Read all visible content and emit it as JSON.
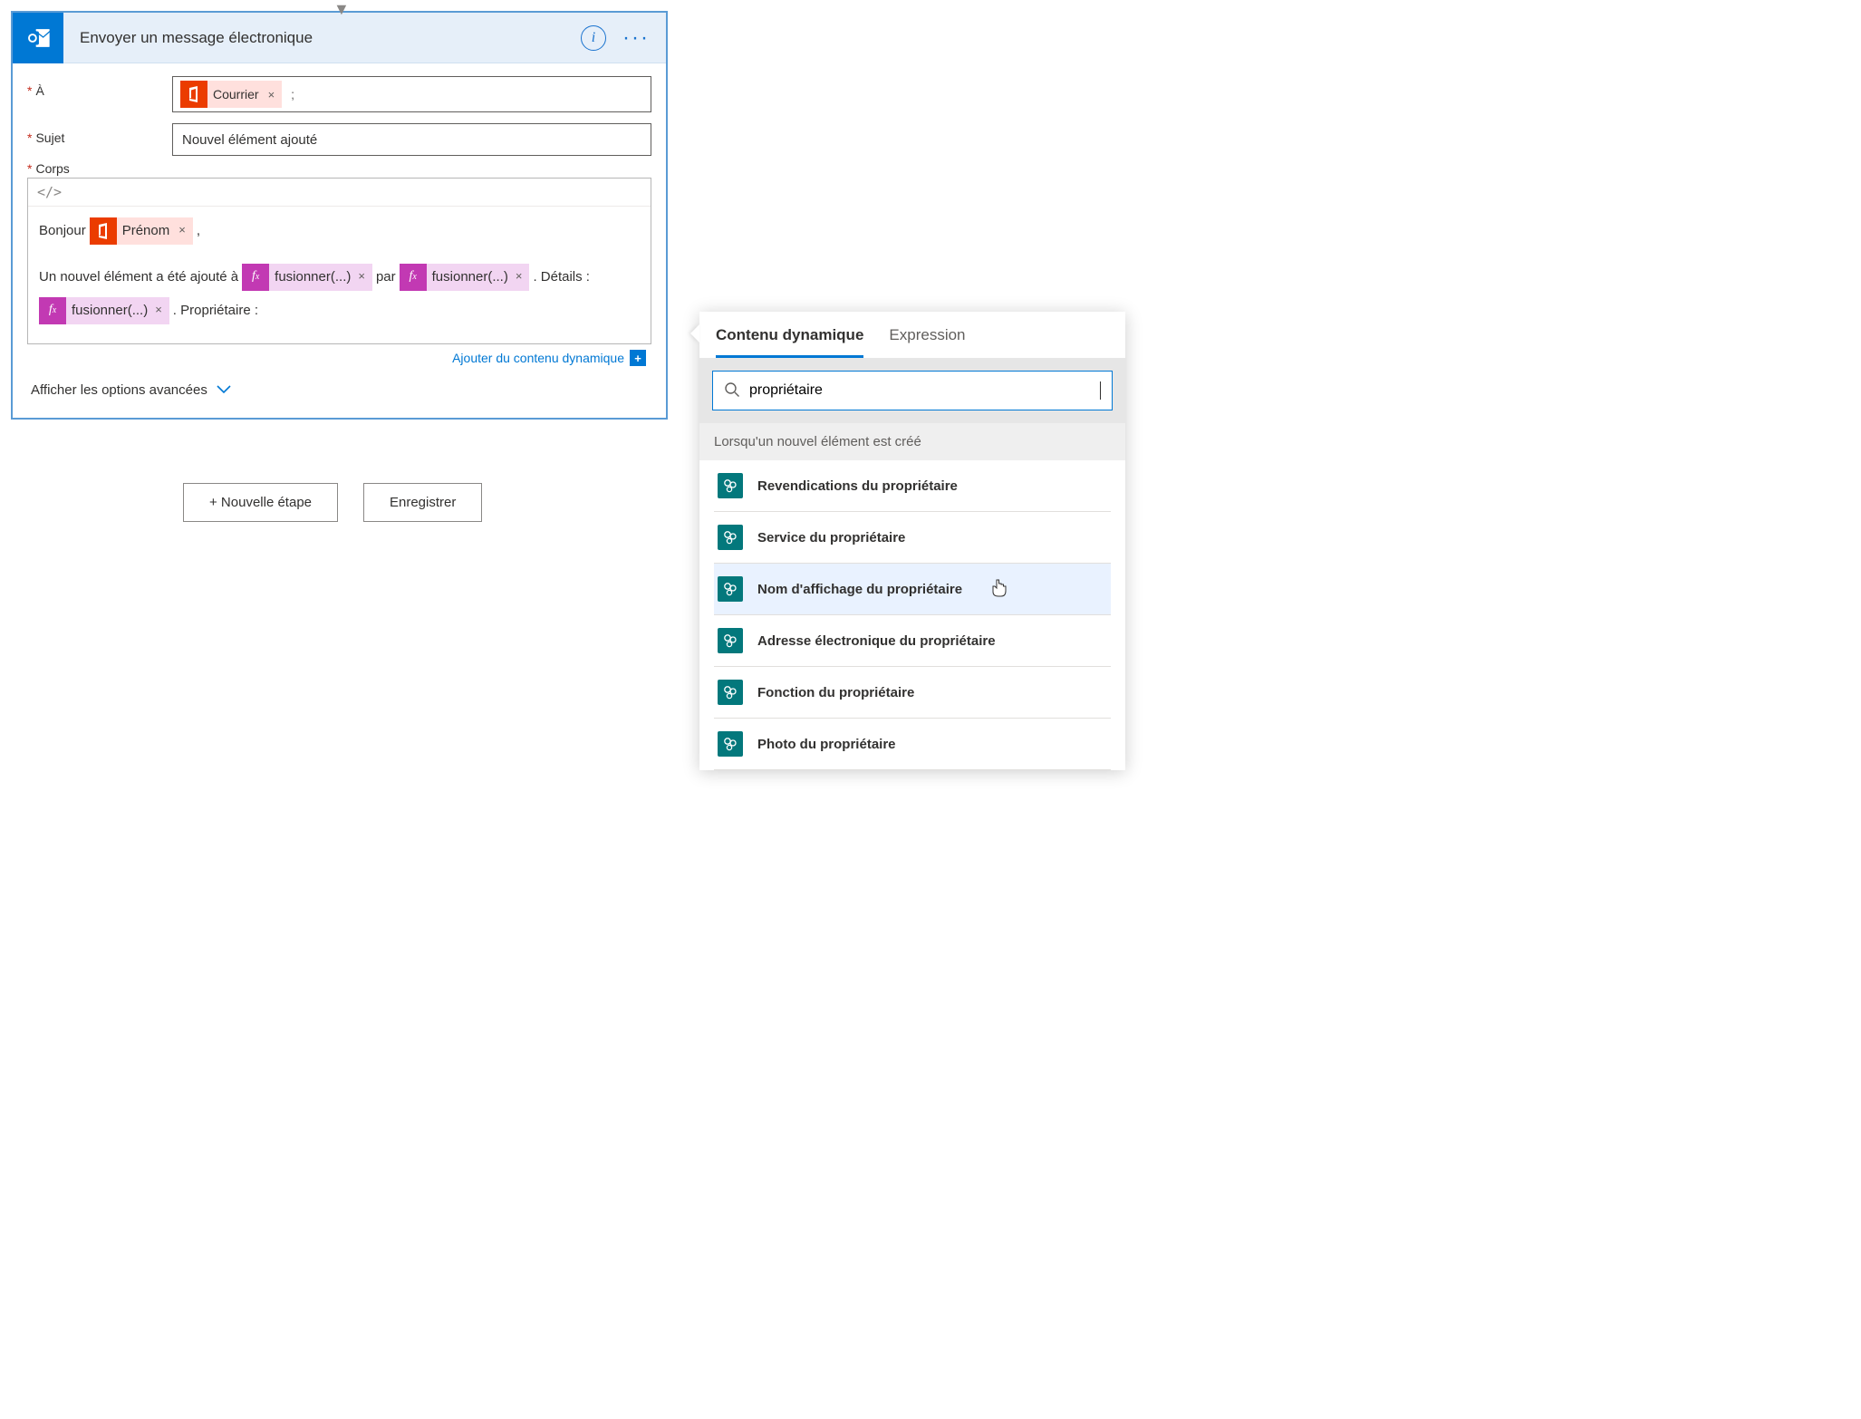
{
  "card": {
    "title": "Envoyer un message électronique"
  },
  "form": {
    "to_label": "À",
    "to_token": "Courrier",
    "to_sep": ";",
    "subject_label": "Sujet",
    "subject_value": "Nouvel élément ajouté",
    "body_label": "Corps",
    "body_toolbar": "</>",
    "line1_prefix": "Bonjour",
    "line1_token": "Prénom",
    "line1_suffix": ",",
    "line2_t1": "Un nouvel élément a été ajouté à",
    "fx_label": "fusionner(...)",
    "line2_t2": "par",
    "line2_t3": ". Détails :",
    "line3_t1": ". Propriétaire :",
    "dynamic_link": "Ajouter du contenu dynamique",
    "advanced": "Afficher les options avancées"
  },
  "footer": {
    "new_step": "+ Nouvelle étape",
    "save": "Enregistrer"
  },
  "panel": {
    "tab_dc": "Contenu dynamique",
    "tab_expr": "Expression",
    "search_value": "propriétaire",
    "section": "Lorsqu'un nouvel élément est créé",
    "items": [
      "Revendications du propriétaire",
      "Service du propriétaire",
      "Nom d'affichage du propriétaire",
      "Adresse électronique du propriétaire",
      "Fonction du propriétaire",
      "Photo du propriétaire"
    ],
    "hover_index": 2
  }
}
